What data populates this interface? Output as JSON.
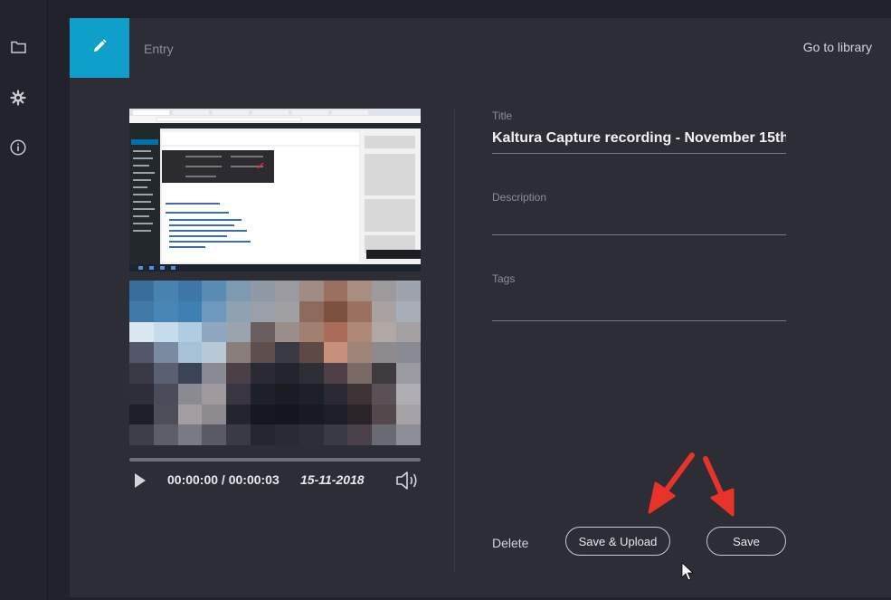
{
  "entry": {
    "label": "Entry",
    "goto_library": "Go to library"
  },
  "player": {
    "time": "00:00:00 / 00:00:03",
    "date": "15-11-2018",
    "progress": 0
  },
  "form": {
    "title_label": "Title",
    "title_value": "Kaltura Capture recording - November 15th",
    "description_label": "Description",
    "description_value": "",
    "tags_label": "Tags",
    "tags_value": ""
  },
  "actions": {
    "delete_label": "Delete",
    "save_upload_label": "Save & Upload",
    "save_label": "Save"
  },
  "colors": {
    "accent": "#0ea0ca",
    "annotation_arrow": "#e8332a"
  }
}
